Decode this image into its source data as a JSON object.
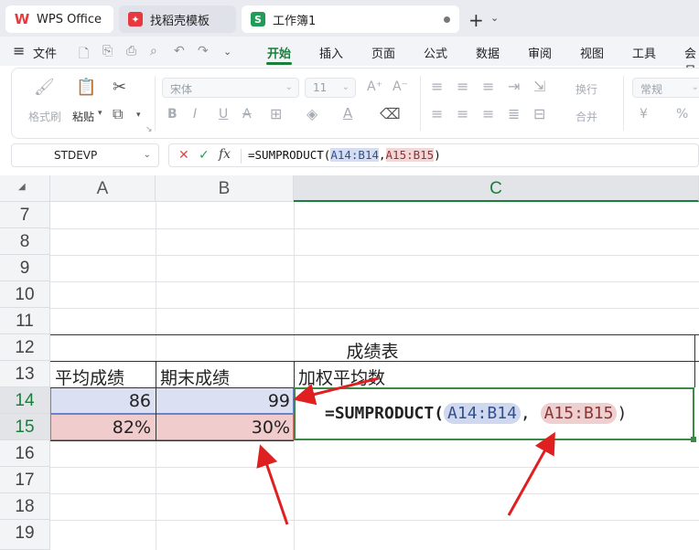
{
  "tabs": {
    "wps_label": "WPS Office",
    "template_label": "找稻壳模板",
    "workbook_label": "工作簿1",
    "new_tab": "+",
    "new_tab_menu": "⌄"
  },
  "menubar": {
    "hamburger": "≡",
    "file": "文件",
    "items": [
      "开始",
      "插入",
      "页面",
      "公式",
      "数据",
      "审阅",
      "视图",
      "工具",
      "会员"
    ]
  },
  "ribbon": {
    "format_painter": "格式刷",
    "paste": "粘贴",
    "font_name": "宋体",
    "font_size": "11",
    "wrap": "换行",
    "merge": "合并",
    "number_format": "常规",
    "currency": "¥",
    "percent": "%"
  },
  "formula_bar": {
    "name_box": "STDEVP",
    "fx": "fx",
    "cancel": "✕",
    "confirm": "✓",
    "prefix": "=SUMPRODUCT(",
    "ref1": "A14:B14",
    "comma": ",",
    "ref2": "A15:B15",
    "suffix": ")"
  },
  "grid": {
    "columns": [
      "A",
      "B",
      "C"
    ],
    "rows": [
      "7",
      "8",
      "9",
      "10",
      "11",
      "12",
      "13",
      "14",
      "15",
      "16",
      "17",
      "18",
      "19"
    ],
    "selected_column": "C",
    "selected_rows": [
      "14",
      "15"
    ]
  },
  "cells": {
    "title": "成绩表",
    "a13": "平均成绩",
    "b13": "期末成绩",
    "c13": "加权平均数",
    "a14": "86",
    "b14": "99",
    "a15": "82%",
    "b15": "30%",
    "c14_prefix": "=SUMPRODUCT(",
    "c14_ref1": "A14:B14",
    "c14_comma": ",",
    "c14_ref2": "A15:B15",
    "c14_suffix": ")"
  },
  "colors": {
    "accent_green": "#1a7f3b",
    "ref1_fill": "#d4ddf2",
    "ref2_fill": "#f3d6d6",
    "arrow_red": "#e02020"
  }
}
